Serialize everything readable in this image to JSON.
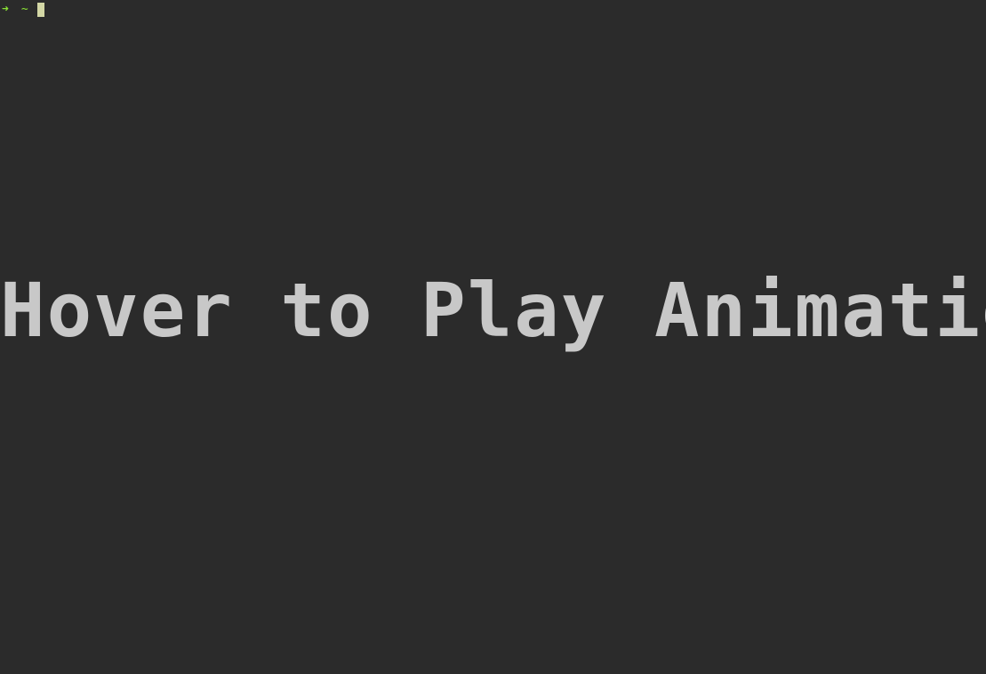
{
  "prompt": {
    "arrow": "➜",
    "tilde": "~"
  },
  "main": {
    "text": "Hover to Play Animation"
  }
}
